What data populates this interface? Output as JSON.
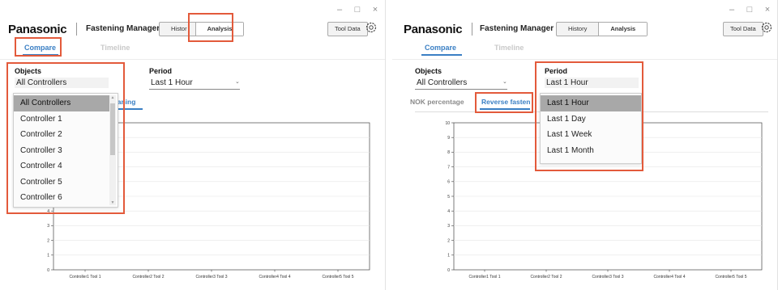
{
  "window_controls": {
    "minimize": "–",
    "maximize": "□",
    "close": "×"
  },
  "header": {
    "brand": "Panasonic",
    "title": "Fastening Manager",
    "history_left": "Histor",
    "history_right": "History",
    "analysis": "Analysis",
    "tool_data": "Tool Data"
  },
  "tabs": {
    "compare": "Compare",
    "timeline": "Timeline"
  },
  "left_panel": {
    "objects_label": "Objects",
    "objects_value": "All Controllers",
    "period_label": "Period",
    "period_value": "Last 1 Hour",
    "subtab_visible": "aaning",
    "subtab_prefix": "a",
    "dropdown_items": [
      "All Controllers",
      "Controller 1",
      "Controller 2",
      "Controller 3",
      "Controller 4",
      "Controller 5",
      "Controller 6"
    ],
    "dropdown_selected": "All Controllers"
  },
  "right_panel": {
    "objects_label": "Objects",
    "objects_value": "All Controllers",
    "period_label": "Period",
    "period_value": "Last 1 Hour",
    "subtab_nok": "NOK percentage",
    "subtab_reverse": "Reverse fasten",
    "dropdown_items": [
      "Last 1 Hour",
      "Last 1 Day",
      "Last 1 Week",
      "Last 1 Month"
    ],
    "dropdown_selected": "Last 1 Hour"
  },
  "chart_data": [
    {
      "type": "bar",
      "categories": [
        "Controller1 Tool 1",
        "Controller2 Tool 2",
        "Controller3 Tool 3",
        "Controller4 Tool 4",
        "Controller5 Tool 5"
      ],
      "y_ticks_visible": [
        "1",
        "2",
        "3",
        "4",
        "0"
      ],
      "ylim": [
        0,
        10
      ],
      "grid": true,
      "values": []
    },
    {
      "type": "bar",
      "categories": [
        "Controller1 Tool 1",
        "Controller2 Tool 2",
        "Controller3 Tool 3",
        "Controller4 Tool 4",
        "Controller5 Tool 5"
      ],
      "y_ticks": [
        "0",
        "1",
        "2",
        "3",
        "4",
        "5",
        "6",
        "7",
        "8",
        "9",
        "10"
      ],
      "ylim": [
        0,
        10
      ],
      "grid": true,
      "values": []
    }
  ],
  "colors": {
    "accent": "#3a7fc4",
    "highlight_box": "#e35a3b",
    "selected_item": "#a8a8a8"
  }
}
